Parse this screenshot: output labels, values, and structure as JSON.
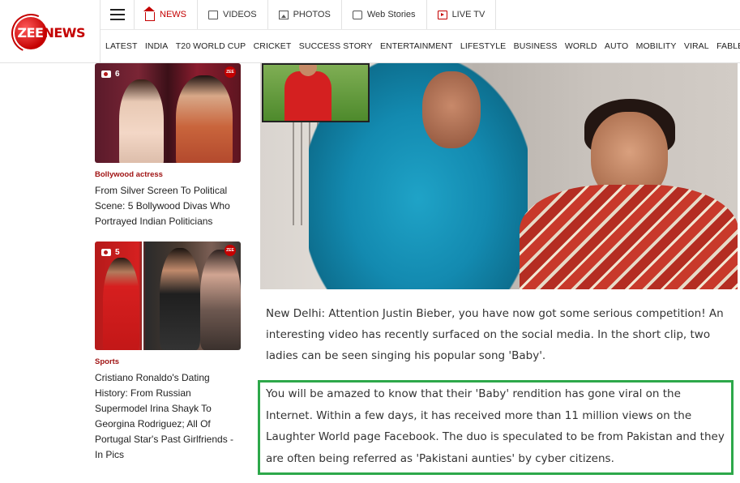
{
  "logo": {
    "part1": "ZEE",
    "part2": "NEWS"
  },
  "topnav": [
    {
      "label": "NEWS",
      "icon": "home-icon"
    },
    {
      "label": "VIDEOS",
      "icon": "tv-icon"
    },
    {
      "label": "PHOTOS",
      "icon": "image-icon"
    },
    {
      "label": "Web Stories",
      "icon": "stories-icon"
    },
    {
      "label": "LIVE TV",
      "icon": "live-tv-icon"
    }
  ],
  "categories": [
    "LATEST",
    "INDIA",
    "T20 WORLD CUP",
    "CRICKET",
    "SUCCESS STORY",
    "ENTERTAINMENT",
    "LIFESTYLE",
    "BUSINESS",
    "WORLD",
    "AUTO",
    "MOBILITY",
    "VIRAL",
    "FABLES OF FAC"
  ],
  "cards": [
    {
      "photo_count": "6",
      "category": "Bollywood actress",
      "title": "From Silver Screen To Political Scene: 5 Bollywood Divas Who Portrayed Indian Politicians"
    },
    {
      "photo_count": "5",
      "category": "Sports",
      "title": "Cristiano Ronaldo's Dating History: From Russian Supermodel Irina Shayk To Georgina Rodriguez; All Of Portugal Star's Past Girlfriends - In Pics"
    }
  ],
  "article": {
    "para1": "New Delhi: Attention Justin Bieber, you have now got some serious competition! An interesting video has recently surfaced on the social media. In the short clip, two ladies can be seen singing his popular song 'Baby'.",
    "para2": "You will be amazed to know that their 'Baby' rendition has gone viral on the Internet. Within a few days, it has received more than 11 million views on the Laughter World page Facebook. The duo is speculated to be from Pakistan and they are often being referred as 'Pakistani aunties' by cyber citizens."
  },
  "colors": {
    "brand": "#c40000",
    "highlight_border": "#2da84a",
    "category_text": "#a01414"
  }
}
